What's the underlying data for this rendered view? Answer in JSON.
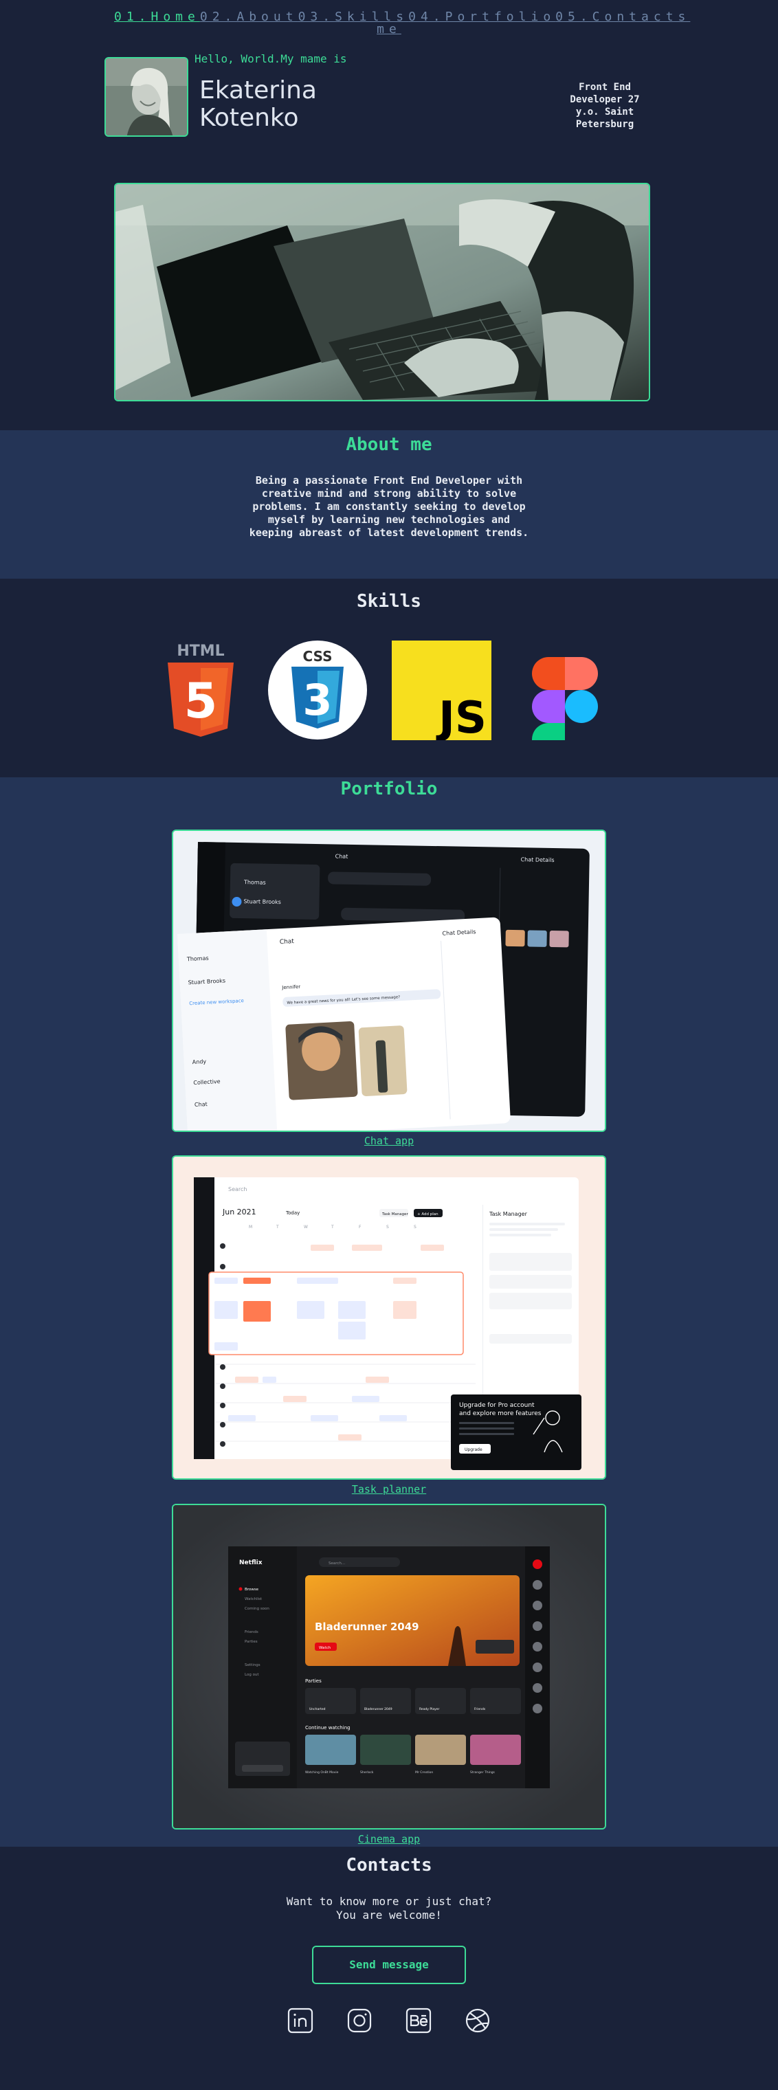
{
  "nav": {
    "items": [
      {
        "label": "01.Home",
        "active": true
      },
      {
        "label": "02.About",
        "active": false
      },
      {
        "label": "03.Skills",
        "active": false
      },
      {
        "label": "04.Portfolio",
        "active": false
      },
      {
        "label": "05.Contacts me",
        "active": false
      }
    ]
  },
  "hero": {
    "greeting": "Hello, World.My mame is",
    "first_name": "Ekaterina",
    "last_name": "Kotenko",
    "role_line1": "Front End",
    "role_line2": "Developer 27",
    "role_line3": "y.o. Saint",
    "role_line4": "Petersburg"
  },
  "about": {
    "title": "About me",
    "line1": "Being a passionate Front End Developer with",
    "line2": "creative mind and strong ability to solve",
    "line3": "problems. I am constantly seeking to develop",
    "line4": "myself by learning new technologies and",
    "line5": "keeping abreast of latest development trends."
  },
  "skills": {
    "title": "Skills",
    "items": [
      {
        "icon": "html5-icon",
        "label": "HTML",
        "mark": "5",
        "color": "#e44d26"
      },
      {
        "icon": "css3-icon",
        "label": "CSS",
        "mark": "3",
        "color": "#1572b6"
      },
      {
        "icon": "javascript-icon",
        "label": "JS",
        "color": "#f7df1e"
      },
      {
        "icon": "figma-icon",
        "color": "#a259ff"
      }
    ]
  },
  "portfolio": {
    "title": "Portfolio",
    "projects": [
      {
        "link": "Chat app"
      },
      {
        "link": "Task planner"
      },
      {
        "link": "Cinema app"
      }
    ],
    "chat": {
      "header": "Chat",
      "details": "Chat Details",
      "contacts": [
        "Thomas",
        "Stuart Brooks",
        "Create new workspace",
        "Andy",
        "Collective",
        "Chat"
      ],
      "message1": "We have a great news for you all! Let's see some message?",
      "sender": "Jennifer"
    },
    "planner": {
      "search": "Search",
      "month": "Jun 2021",
      "today": "Today",
      "task_manager": "Task Manager",
      "add": "+ Add plan",
      "days": [
        "M",
        "T",
        "W",
        "T",
        "F",
        "S",
        "S"
      ],
      "promo_line1": "Upgrade for Pro account",
      "promo_line2": "and explore more features",
      "promo_btn": "Upgrade"
    },
    "cinema": {
      "brand": "Netflix",
      "search": "Search...",
      "movie": "Bladerunner 2049",
      "watch": "Watch",
      "parties": "Parties",
      "continue": "Continue watching",
      "items": [
        "Uncharted",
        "Bladerunner 2049",
        "Ready Player",
        "Friends"
      ],
      "continue_items": [
        "Watching OnBt Movie",
        "Sherlock",
        "Mr Creation",
        "Stranger Things"
      ],
      "menu": [
        "Browse",
        "Watchlist",
        "Coming soon",
        "Friends",
        "Parties",
        "Settings",
        "Log out"
      ]
    }
  },
  "contacts": {
    "title": "Contacts",
    "line1": "Want to know more or just chat?",
    "line2": "You are welcome!",
    "button": "Send message",
    "socials": [
      "linkedin-icon",
      "instagram-icon",
      "behance-icon",
      "dribbble-icon"
    ]
  }
}
